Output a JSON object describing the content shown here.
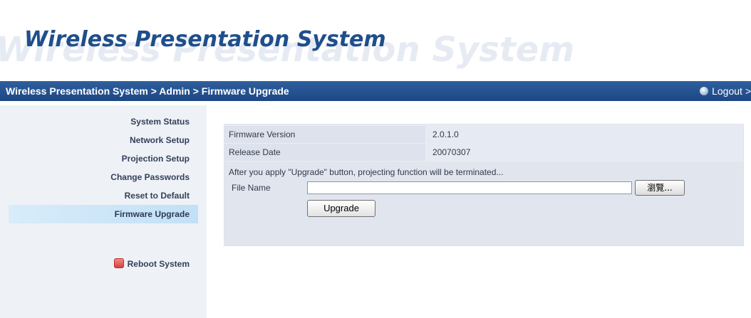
{
  "header": {
    "title": "Wireless Presentation System"
  },
  "navbar": {
    "breadcrumb": "Wireless Presentation System > Admin > Firmware Upgrade",
    "logout_label": "Logout >",
    "logout_icon": "logout-icon"
  },
  "sidebar": {
    "items": [
      {
        "label": "System Status"
      },
      {
        "label": "Network Setup"
      },
      {
        "label": "Projection Setup"
      },
      {
        "label": "Change Passwords"
      },
      {
        "label": "Reset to Default"
      },
      {
        "label": "Firmware Upgrade",
        "active": true
      }
    ],
    "reboot_label": "Reboot System",
    "reboot_icon": "reboot-icon"
  },
  "firmware": {
    "version_label": "Firmware Version",
    "version_value": "2.0.1.0",
    "date_label": "Release Date",
    "date_value": "20070307",
    "note": "After you apply \"Upgrade\" button, projecting function will be terminated...",
    "file_label": "File Name",
    "file_value": "",
    "browse_label": "瀏覽...",
    "upgrade_label": "Upgrade"
  },
  "colors": {
    "nav_bar": "#1d4784",
    "title": "#1f4e8c",
    "active_item": "#c2e0f6",
    "reboot": "#d8403a"
  }
}
